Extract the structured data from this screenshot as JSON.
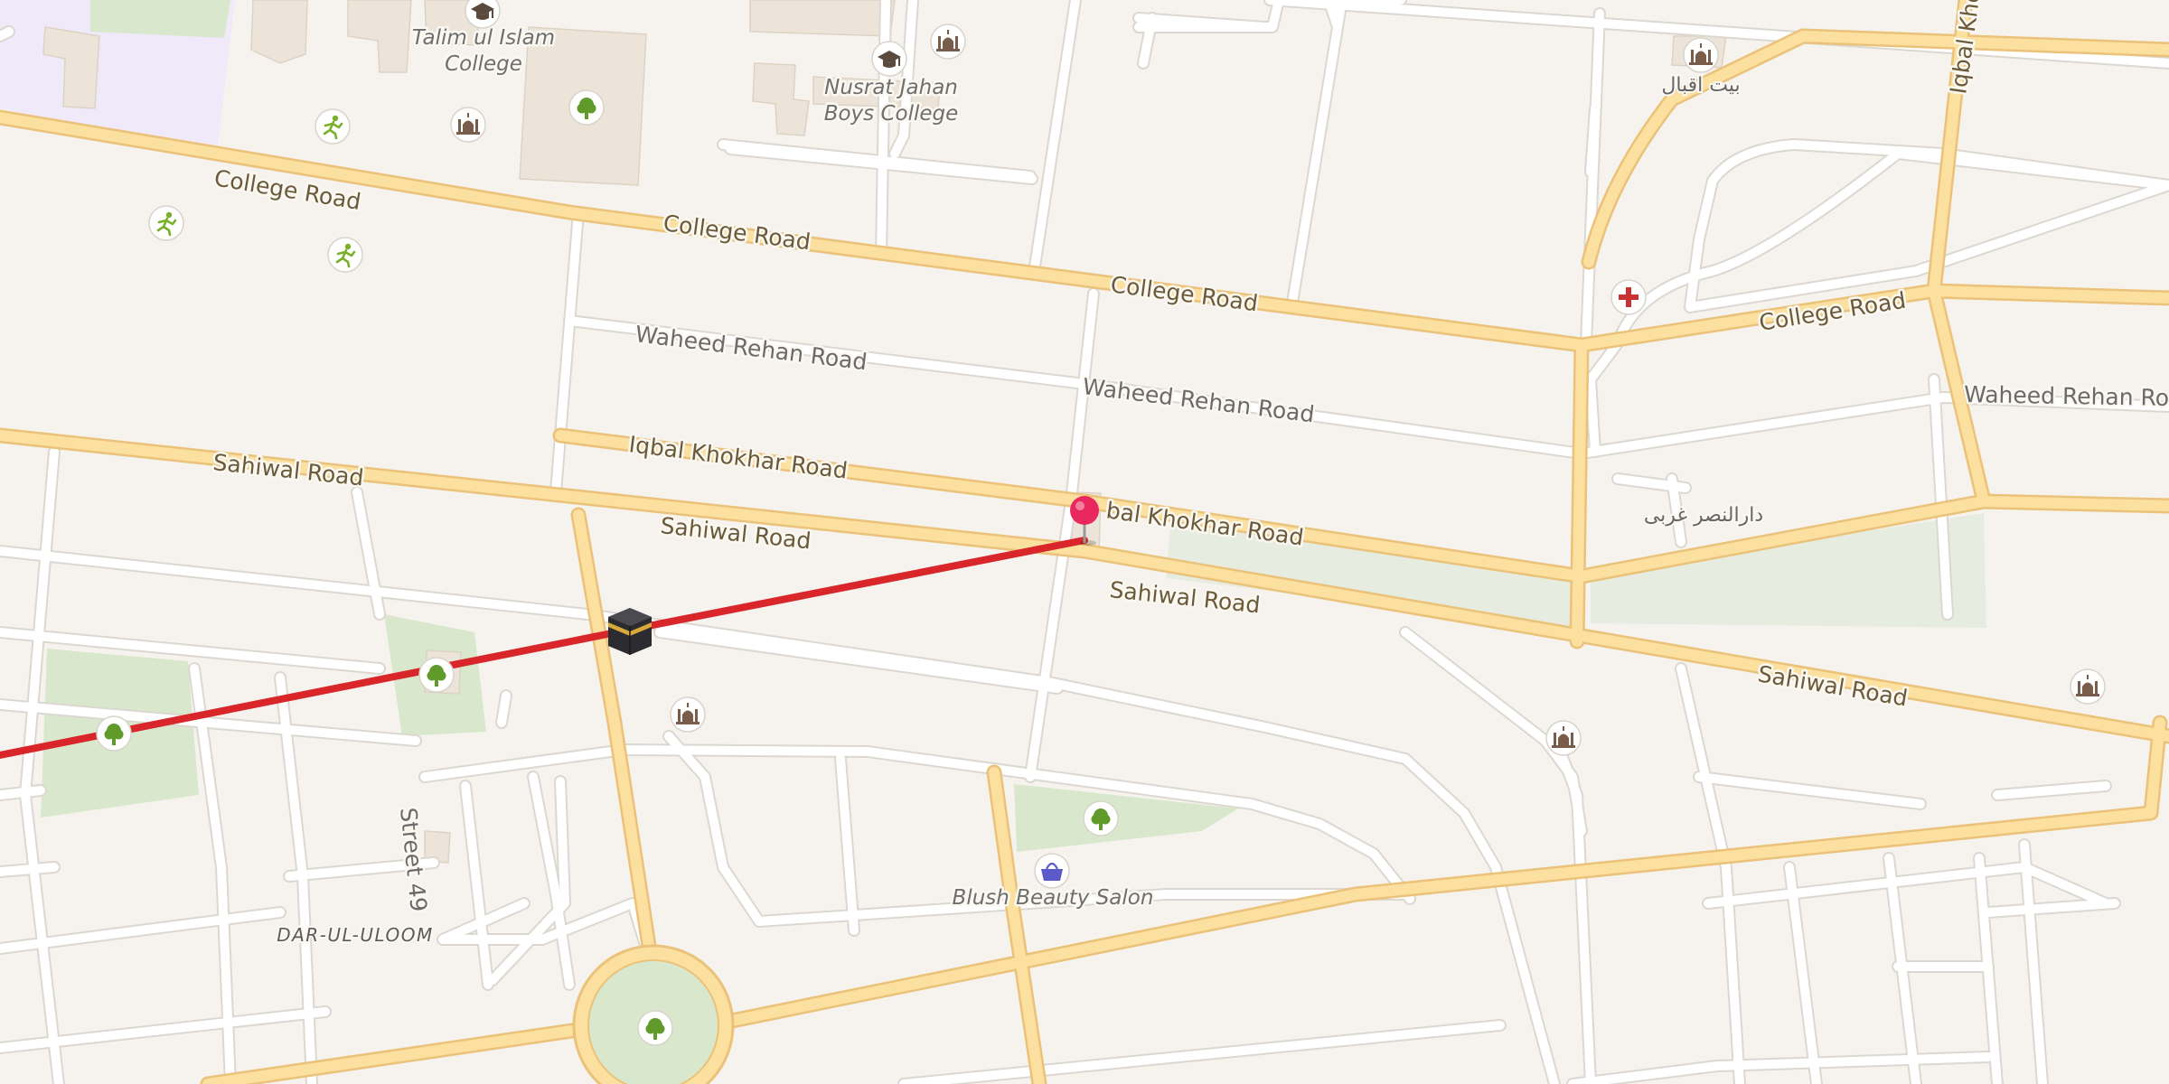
{
  "map": {
    "colors": {
      "background": "#f6f3ee",
      "major_road_fill": "#fbe0a0",
      "major_road_casing": "#ebc27a",
      "minor_road": "#ffffff",
      "minor_road_casing": "#dcd8d1",
      "park": "#d9e8cc",
      "campus": "#efe9f9",
      "building": "#ece4d8",
      "route_line": "#d8262a",
      "pin": "#e8285e",
      "tree_icon": "#5f9a2a",
      "sport_icon": "#7ab02a",
      "mosque_icon": "#7a5c4a",
      "shop_icon": "#5a5ac8",
      "medical_icon": "#c83232"
    },
    "roads": {
      "college_road": "College Road",
      "waheed_rehan_road": "Waheed Rehan Road",
      "waheed_rehan_road_east": "Waheed Rehan Roa",
      "iqbal_khokhar_road": "Iqbal Khokhar Road",
      "iqbal_khokhar_road_partial": "bal Khokhar Road",
      "sahiwal_road": "Sahiwal Road",
      "street_49": "Street 49",
      "iqbal_north": "Iqbal Khc"
    },
    "places": {
      "talim_ul_islam_line1": "Talim ul Islam",
      "talim_ul_islam_line2": "College",
      "nusrat_jahan_line1": "Nusrat Jahan",
      "nusrat_jahan_line2": "Boys College",
      "blush_beauty_salon": "Blush Beauty Salon",
      "dar_ul_uloom": "DAR-UL-ULOOM",
      "bait_ul_iqbal": "بیت اقبال",
      "dar_ul_nasr_gharbi": "دارالنصر غربی"
    },
    "icons": {
      "tree": "tree-icon",
      "sport": "sport-icon",
      "mosque": "mosque-icon",
      "college": "graduation-cap-icon",
      "shop": "shopping-basket-icon",
      "medical": "medical-cross-icon",
      "kaaba": "kaaba-icon",
      "pin": "map-pin-icon"
    }
  }
}
